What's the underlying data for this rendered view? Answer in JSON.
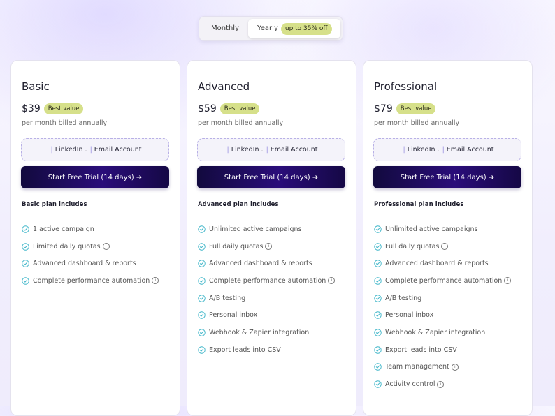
{
  "billing_toggle": {
    "monthly_label": "Monthly",
    "yearly_label": "Yearly",
    "yearly_badge": "up to 35% off",
    "selected": "Yearly"
  },
  "colors": {
    "badge": "#d6e08a",
    "button": "#1f0c5e",
    "check": "#3fb6c9"
  },
  "plans": [
    {
      "name": "Basic",
      "price": "$39",
      "badge": "Best value",
      "billing": "per month billed annually",
      "accounts": {
        "linkedin": "LinkedIn .",
        "email": "Email Account"
      },
      "cta": "Start Free Trial (14 days) ➔",
      "includes_title": "Basic plan includes",
      "features": [
        {
          "text": "1 active campaign",
          "info": false
        },
        {
          "text": "Limited daily quotas",
          "info": true
        },
        {
          "text": "Advanced dashboard & reports",
          "info": false
        },
        {
          "text": "Complete performance automation",
          "info": true
        }
      ]
    },
    {
      "name": "Advanced",
      "price": "$59",
      "badge": "Best value",
      "billing": "per month billed annually",
      "accounts": {
        "linkedin": "LinkedIn .",
        "email": "Email Account"
      },
      "cta": "Start Free Trial (14 days) ➔",
      "includes_title": "Advanced plan includes",
      "features": [
        {
          "text": "Unlimited active campaigns",
          "info": false
        },
        {
          "text": "Full daily quotas",
          "info": true
        },
        {
          "text": "Advanced dashboard & reports",
          "info": false
        },
        {
          "text": "Complete performance automation",
          "info": true
        },
        {
          "text": "A/B testing",
          "info": false
        },
        {
          "text": "Personal inbox",
          "info": false
        },
        {
          "text": "Webhook & Zapier integration",
          "info": false
        },
        {
          "text": "Export leads into CSV",
          "info": false
        }
      ]
    },
    {
      "name": "Professional",
      "price": "$79",
      "badge": "Best value",
      "billing": "per month billed annually",
      "accounts": {
        "linkedin": "LinkedIn .",
        "email": "Email Account"
      },
      "cta": "Start Free Trial (14 days) ➔",
      "includes_title": "Professional plan includes",
      "features": [
        {
          "text": "Unlimited active campaigns",
          "info": false
        },
        {
          "text": "Full daily quotas",
          "info": true
        },
        {
          "text": "Advanced dashboard & reports",
          "info": false
        },
        {
          "text": "Complete performance automation",
          "info": true
        },
        {
          "text": "A/B testing",
          "info": false
        },
        {
          "text": "Personal inbox",
          "info": false
        },
        {
          "text": "Webhook & Zapier integration",
          "info": false
        },
        {
          "text": "Export leads into CSV",
          "info": false
        },
        {
          "text": "Team management",
          "info": true
        },
        {
          "text": "Activity control",
          "info": true
        }
      ]
    }
  ]
}
